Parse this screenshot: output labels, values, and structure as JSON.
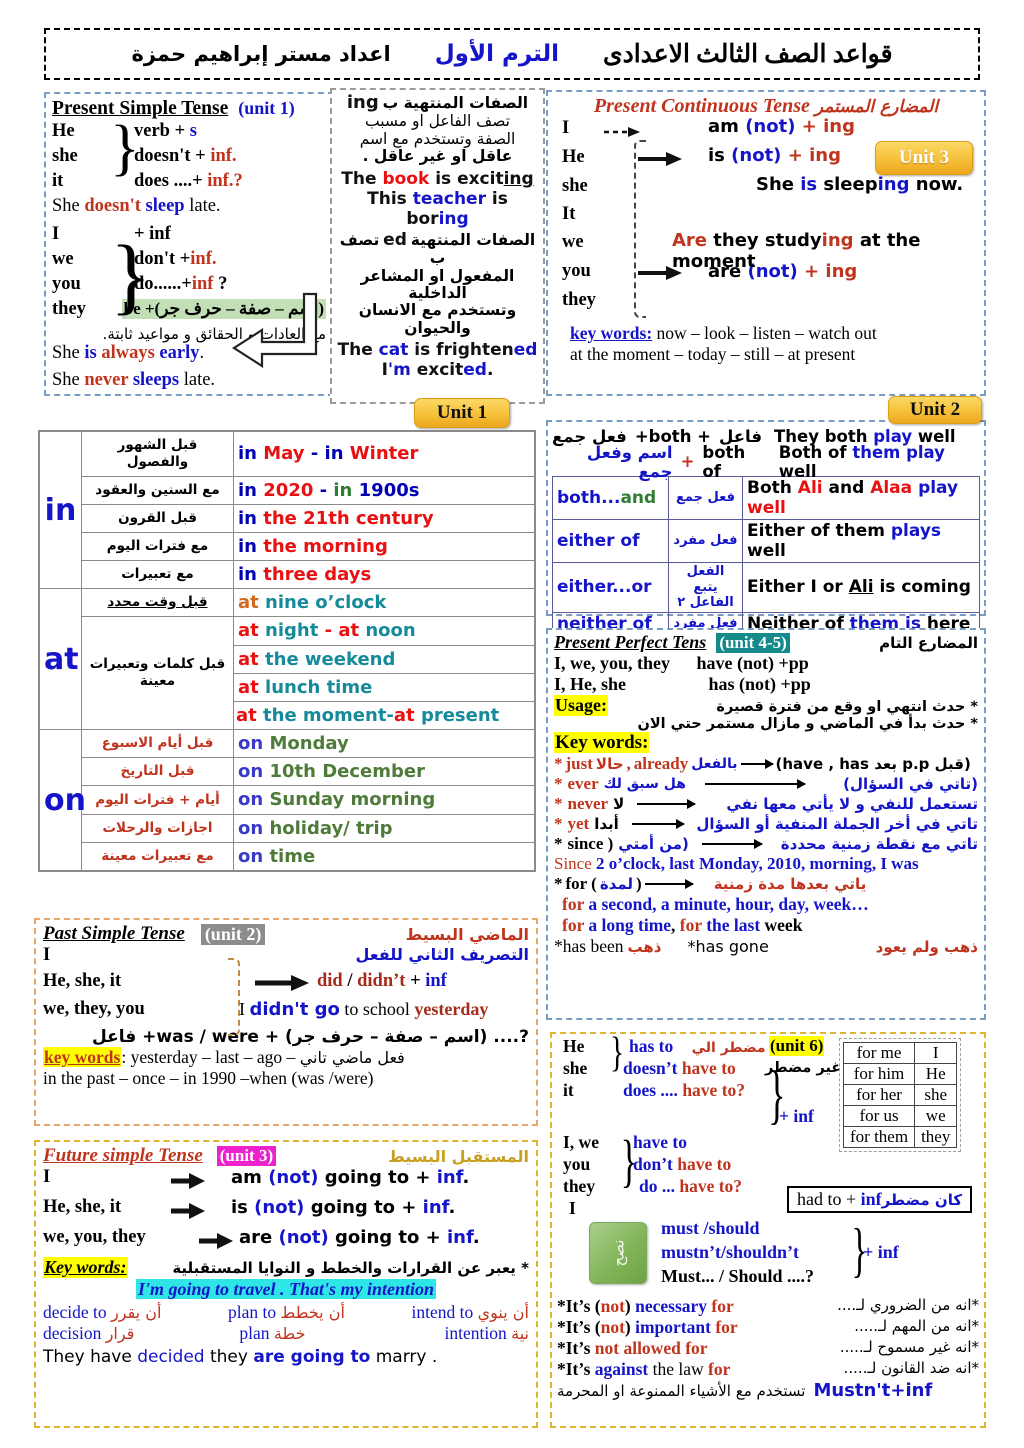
{
  "header": {
    "title": "قواعد الصف الثالث الاعدادى",
    "term": "الترم الأول",
    "author": "اعداد مستر إبراهيم حمزة"
  },
  "colors": {
    "accent_red": "#c0341d",
    "accent_blue": "#1414c8",
    "badge_gold": "#f6c33c",
    "highlight_yellow": "#ffff00",
    "highlight_green": "#c3dfb6",
    "highlight_cyan": "#2ee6e6",
    "highlight_teal": "#148a8a",
    "highlight_magenta": "#ee22cc",
    "highlight_gray": "#8c8c8c"
  },
  "badges": {
    "unit1": "Unit 1",
    "unit2": "Unit 2",
    "unit3": "Unit 3"
  },
  "present_simple": {
    "title": "Present Simple Tense",
    "unit": "(unit 1)",
    "group1": {
      "pronouns": [
        "He",
        "she",
        "it"
      ],
      "forms": [
        "verb  + s",
        "doesn't + inf.",
        "does ....+ inf.?"
      ],
      "form_plain": [
        "verb  + ",
        "doesn't + ",
        "does ....+ "
      ],
      "form_accent": [
        "s",
        "inf.",
        "inf.?"
      ]
    },
    "example1_pre": "She ",
    "example1_neg": "doesn't ",
    "example1_verb": "sleep",
    "example1_post": " late.",
    "group2": {
      "pronouns": [
        "I",
        "we",
        "you",
        "they"
      ],
      "forms": [
        "+ inf",
        "don't +inf.",
        "do......+inf ?",
        "be +(اسم – صفة – حرف جر)"
      ]
    },
    "note_arabic": "مع العادات و الحقائق و مواعيد ثابتة.",
    "example2_pre": "She ",
    "example2_is": "is",
    "example2_mid": " always ",
    "example2_adj": "early",
    "example2_post": ".",
    "example3_pre": "She ",
    "example3_never": "never",
    "example3_verb": " sleeps",
    "example3_post": " late."
  },
  "adjectives": {
    "line1_ar": "الصفات المنتهية ب",
    "line1_en": "ing",
    "line2_ar": "تصف الفاعل او مسبب",
    "line3_ar": "الصفة وتستخدم مع اسم",
    "line4_ar": "عاقل او غير عاقل .",
    "ex1": {
      "pre": "The ",
      "word": "book",
      "mid": " is excit",
      "suffix": "ing"
    },
    "ex2": {
      "pre": "This ",
      "word": "teacher",
      "mid": " is bor",
      "suffix": "ing"
    },
    "line5_ar": "الصفات المنتهية ب",
    "line5_en": "ed",
    "line5_ar2": "تصف",
    "line6_ar": "المفعول او المشاعر الداخلية",
    "line7_ar": "وتستخدم مع الانسان والحيوان",
    "ex3": {
      "pre": "The ",
      "word": "cat",
      "mid": " is frighten",
      "suffix": "ed"
    },
    "ex4": {
      "pre": "I",
      "word": "'m",
      "mid": " excit",
      "suffix": "ed",
      "post": "."
    }
  },
  "present_continuous": {
    "title_en": "Present Continuous Tense",
    "title_ar": "المضارع المستمر",
    "pronouns": [
      "I",
      "He",
      "she",
      "It",
      "we",
      "you",
      "they"
    ],
    "form_am": {
      "verb": "am",
      "not": "(not)",
      "plus": "+",
      "ing": "ing"
    },
    "form_is": {
      "verb": "is",
      "not": "(not)",
      "plus": "+",
      "ing": "ing"
    },
    "form_are": {
      "verb": "are",
      "not": "(not)",
      "plus": "+",
      "ing": "ing"
    },
    "example_is": {
      "pre": "She ",
      "be": "is",
      "mid": " sleep",
      "ing": "ing",
      "post": " now."
    },
    "example_are": {
      "be": "Are",
      "mid": " they study",
      "ing": "ing",
      "post": " at the moment"
    },
    "key_label": "key words:",
    "key_line1": " now – look – listen – watch out",
    "key_line2": "at the moment – today – still – at present"
  },
  "prepositions": {
    "groups": [
      {
        "key": "in",
        "rows": [
          {
            "ar": "قبل الشهور والفصول",
            "parts": [
              [
                "in ",
                "blue"
              ],
              [
                "May",
                "red"
              ],
              [
                " - ",
                "blue"
              ],
              [
                "in ",
                "blue"
              ],
              [
                "Winter",
                "red"
              ]
            ]
          },
          {
            "ar": "مع السنين والعقود",
            "parts": [
              [
                "in ",
                "blue"
              ],
              [
                "2020",
                "red"
              ],
              [
                " - ",
                "blue"
              ],
              [
                "in ",
                "green"
              ],
              [
                "1900s",
                "blue"
              ]
            ]
          },
          {
            "ar": "قبل القرون",
            "parts": [
              [
                "in ",
                "blue"
              ],
              [
                "the 21th century",
                "red"
              ]
            ]
          },
          {
            "ar": "مع فترات اليوم",
            "parts": [
              [
                "in ",
                "blue"
              ],
              [
                "the morning",
                "red"
              ]
            ]
          },
          {
            "ar": "مع تعبيرات",
            "parts": [
              [
                "in ",
                "blue"
              ],
              [
                "three days",
                "red"
              ]
            ]
          }
        ]
      },
      {
        "key": "at",
        "rows": [
          {
            "ar": "قبل وقت محدد",
            "ar_underline": true,
            "parts": [
              [
                "at ",
                "orange"
              ],
              [
                "nine o'clock",
                "teal"
              ]
            ]
          },
          {
            "ar": "قبل كلمات وتعبيرات معينة",
            "rowspan": 3,
            "parts": [
              [
                "at ",
                "red"
              ],
              [
                "night",
                "teal"
              ],
              [
                " - ",
                "red"
              ],
              [
                "at ",
                "red"
              ],
              [
                "noon",
                "teal"
              ]
            ]
          },
          {
            "parts": [
              [
                "at ",
                "red"
              ],
              [
                "the weekend",
                "teal"
              ]
            ]
          },
          {
            "parts": [
              [
                "at ",
                "red"
              ],
              [
                "lunch time",
                "teal"
              ]
            ]
          },
          {
            "parts": [
              [
                "at ",
                "red"
              ],
              [
                "the moment-",
                "teal"
              ],
              [
                "at ",
                "red"
              ],
              [
                "present",
                "teal"
              ]
            ]
          }
        ]
      },
      {
        "key": "on",
        "rows": [
          {
            "ar": "قبل أيام الاسبوع",
            "ar_color": "red",
            "parts": [
              [
                "on ",
                "blue"
              ],
              [
                "Monday",
                "green"
              ]
            ]
          },
          {
            "ar": "قبل التاريخ",
            "ar_color": "red",
            "parts": [
              [
                "on ",
                "blue"
              ],
              [
                "10th December",
                "green"
              ]
            ]
          },
          {
            "ar": "أيام + فترات اليوم",
            "ar_color": "red",
            "parts": [
              [
                "on ",
                "blue"
              ],
              [
                "Sunday morning",
                "green"
              ]
            ]
          },
          {
            "ar": "اجازات والرحلات",
            "ar_color": "red",
            "parts": [
              [
                "on ",
                "blue"
              ],
              [
                "holiday/ trip",
                "green"
              ]
            ]
          },
          {
            "ar": "مع تعبيرات معينة",
            "ar_color": "red",
            "parts": [
              [
                "on ",
                "blue"
              ],
              [
                "time",
                "green"
              ]
            ]
          }
        ]
      }
    ]
  },
  "both": {
    "line1": {
      "ar_right": "فاعل",
      "plus": "+both +",
      "ar_mid": "فعل جمع",
      "en": "They both play well",
      "en_pre": "They both ",
      "en_accent": "play",
      "en_post": " well"
    },
    "line2": {
      "en_left": "both of",
      "plus": "+",
      "ar_mid": "اسم وفعل جمع",
      "en_pre": "Both of ",
      "en_accent": "them play",
      "en_post": " well"
    },
    "rows": [
      {
        "key": "both...and",
        "key_parts": [
          [
            "both...",
            "blue"
          ],
          [
            "and",
            "green"
          ]
        ],
        "ar": "فعل جمع",
        "ex_parts": [
          [
            "Both ",
            "black"
          ],
          [
            "Ali",
            "red"
          ],
          [
            " and ",
            "black"
          ],
          [
            "Alaa",
            "red"
          ],
          [
            " ",
            "black"
          ],
          [
            "play",
            "blue"
          ],
          [
            " ",
            "black"
          ],
          [
            "well",
            "red"
          ]
        ]
      },
      {
        "key": "either of",
        "ar": "فعل مفرد",
        "ex_parts": [
          [
            "Either of them ",
            "black"
          ],
          [
            "plays",
            "blue"
          ],
          [
            " well",
            "black"
          ]
        ]
      },
      {
        "key": "either...or",
        "ar": "الفعل يتبع الفاعل ٢",
        "ex_parts": [
          [
            "Either I or ",
            "black"
          ],
          [
            "Ali",
            "underline"
          ],
          [
            " is coming",
            "black"
          ]
        ]
      },
      {
        "key": "neither of",
        "ar": "فعل مفرد",
        "ex_parts": [
          [
            "Neither of ",
            "black"
          ],
          [
            "them is",
            "blue"
          ],
          [
            " here",
            "black"
          ]
        ]
      }
    ]
  },
  "present_perfect": {
    "title_en": "Present Perfect Tens",
    "unit": "(unit 4-5)",
    "title_ar": "المضارع التام",
    "row1_subj": "I, we, you, they",
    "row1_form": "have (not) +pp",
    "row2_subj": "I, He, she",
    "row2_form": "has (not) +pp",
    "usage_label": "Usage:",
    "usage1_ar": "* حدث انتهي او وقع من فترة قصيرة",
    "usage2_ar": "* حدث بدأ في الماضي و مازال مستمر حتي الان",
    "keywords_label": "Key words:",
    "kw_just": {
      "star": "* ",
      "word": "just",
      "ar": "حالا",
      "comma": ", ",
      "word2": "already",
      "ar2": "بالفعل",
      "note": "(قبل p.p بعد have , has)"
    },
    "kw_ever": {
      "star": "* ",
      "word": "ever",
      "ar": "هل سبق لك",
      "note": "(تاتي في السؤال)"
    },
    "kw_never": {
      "star": "* ",
      "word": "never",
      "ar": "لا",
      "note": "تستعمل للنفي و لا يأتي معها نفي"
    },
    "kw_yet": {
      "star": "* ",
      "word": "yet",
      "ar": "أبدا",
      "note": "تاتي في أخر الجملة المنفية أو السؤال"
    },
    "kw_since": {
      "star": "*",
      "word": "since )",
      "ar": "(من أمتي",
      "note": "تاتي مع نقطة زمنية محددة"
    },
    "since_ex": {
      "pre": "Since ",
      "body": "2 o’clock, last Monday, 2010, morning, I was"
    },
    "kw_for": {
      "star": "* ",
      "word": "for (",
      "ar": "لمدة",
      "close": ")",
      "note": "ياتي بعدها مدة زمنية"
    },
    "for_ex1": {
      "word": "for",
      "rest": " a second, a minute, hour, day, week…"
    },
    "for_ex2": {
      "w1": "for",
      "r1": " a long time",
      "sep": ", ",
      "w2": "for",
      "r2": " the last",
      "tail": " week"
    },
    "been": {
      "star": "* ",
      "en": "has  been ",
      "ar": "ذهب"
    },
    "gone": {
      "star": "*",
      "en": "has gone ",
      "ar": "ذهب ولم يعود"
    }
  },
  "past_simple": {
    "title": "Past Simple Tense",
    "unit": "(unit 2)",
    "title_ar": "الماضي البسيط",
    "subtitle_ar": "التصريف الثاني للفعل",
    "pronouns": [
      "I",
      "He, she, it",
      "we, they, you"
    ],
    "form": {
      "did": "did",
      "slash": " / ",
      "didnt": "didn’t",
      "plus": " + ",
      "inf": "inf"
    },
    "example": {
      "pre": "I ",
      "neg": "didn't go",
      "mid": " to school ",
      "kw": "yesterday"
    },
    "rule_ar": "?.... (اسم – صفة – حرف جر) + was / were+ فاعل",
    "key_label": "key words",
    "key_line1": ": yesterday – last – ago – ",
    "key_ar": "فعل ماضي تاني",
    "key_line2": "in the past – once – in 1990 –when (was /were)"
  },
  "future_simple": {
    "title": "Future simple Tense",
    "unit": "(unit 3)",
    "title_ar": "المستقبل البسيط",
    "rows": [
      {
        "pron": "I",
        "be": "am",
        "not": "(not)",
        "rest": " going to + ",
        "inf": "inf",
        "dot": "."
      },
      {
        "pron": "He, she, it",
        "be": "is",
        "not": "(not)",
        "rest": " going to + ",
        "inf": "inf",
        "dot": "."
      },
      {
        "pron": "we, you, they",
        "be": "are",
        "not": "(not)",
        "rest": " going to + ",
        "inf": "inf",
        "dot": "."
      }
    ],
    "key_label": "Key words:",
    "key_ar": "* يعبر عن القرارات والخطط و النوايا المستقبلية",
    "highlight_ex": "I'm going to travel . That's my intention",
    "vocab_row1": [
      {
        "en": "decide to",
        "ar": "أن يقرر"
      },
      {
        "en": "plan to",
        "ar": "أن يخطط"
      },
      {
        "en": "intend to",
        "ar": "أن ينوي"
      }
    ],
    "vocab_row2": [
      {
        "en": "decision",
        "ar": "قرار"
      },
      {
        "en": "plan",
        "ar": "خطة"
      },
      {
        "en": "intention",
        "ar": "نية"
      }
    ],
    "final_ex": {
      "pre": "They have ",
      "w1": "decided",
      "mid": " they ",
      "w2": "are going to",
      "post": " marry ."
    }
  },
  "have_to": {
    "unit": "(unit 6)",
    "group1": {
      "pronouns": [
        "He",
        "she",
        "it"
      ],
      "forms": [
        {
          "blue": "has to",
          "red": "",
          "ar": "مضطر الي"
        },
        {
          "blue": "doesn’t ",
          "red": "have to"
        },
        {
          "blue": "does .... ",
          "red": "have to?"
        }
      ]
    },
    "group1_ar": "غير مضطر",
    "plus_inf": "+ inf",
    "group2": {
      "pronouns": [
        "I, we",
        "you",
        "they",
        "I"
      ],
      "forms": [
        {
          "blue": "have to"
        },
        {
          "blue": "don’t ",
          "red": "have to"
        },
        {
          "blue": "do ... ",
          "red": "have to?"
        }
      ]
    },
    "for_table": [
      [
        "for me",
        "I"
      ],
      [
        "for him",
        "He"
      ],
      [
        "for her",
        "she"
      ],
      [
        "for us",
        "we"
      ],
      [
        "for them",
        "they"
      ]
    ],
    "had_to": {
      "en": "had to + ",
      "inf": "inf",
      "ar": "كان مضطر"
    },
    "green_box_ar": "نصح",
    "modals": [
      "must /should",
      "mustn’t/shouldn’t",
      "Must... / Should ....?"
    ],
    "modal_plus": "+ inf",
    "expressions": [
      {
        "pre": "*It’s (",
        "not": "not",
        "mid": ") ",
        "blue": "necessary",
        "red": " for",
        "ar": "*انه من الضروري لـ...."
      },
      {
        "pre": "*It’s (",
        "not": "not",
        "mid": ")  ",
        "blue": "important",
        "red": " for",
        "ar": "*انه من المهم لـ....."
      },
      {
        "pre": "*It’s ",
        "red2": "not allowed",
        "red": "  for",
        "ar": "*انه غير مسموح لـ....."
      },
      {
        "pre": "*It’s ",
        "blue": "against",
        "mid2": " the law ",
        "red": "for",
        "ar": "*انه ضد القانون لـ....."
      }
    ],
    "footer": {
      "en": "Mustn't+inf",
      "ar": "تستخدم مع الأشياء الممنوعة او المحرمة"
    }
  }
}
